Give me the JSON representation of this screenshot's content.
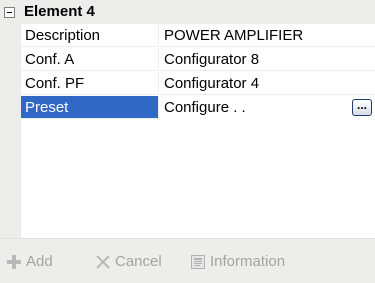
{
  "group": {
    "title": "Element 4"
  },
  "rows": [
    {
      "name": "Description",
      "value": "POWER AMPLIFIER"
    },
    {
      "name": "Conf. A",
      "value": "Configurator 8"
    },
    {
      "name": "Conf. PF",
      "value": "Configurator 4"
    },
    {
      "name": "Preset",
      "value": "Configure . ."
    }
  ],
  "ellipsis_label": "...",
  "toolbar": {
    "add_label": "Add",
    "cancel_label": "Cancel",
    "information_label": "Information"
  },
  "icons": {
    "toggle": "collapse-minus-icon",
    "add": "plus-icon",
    "cancel": "x-icon",
    "information": "information-icon"
  },
  "colors": {
    "selection": "#3168c6",
    "disabled_text": "#a3a3a3",
    "panel": "#ededec"
  }
}
